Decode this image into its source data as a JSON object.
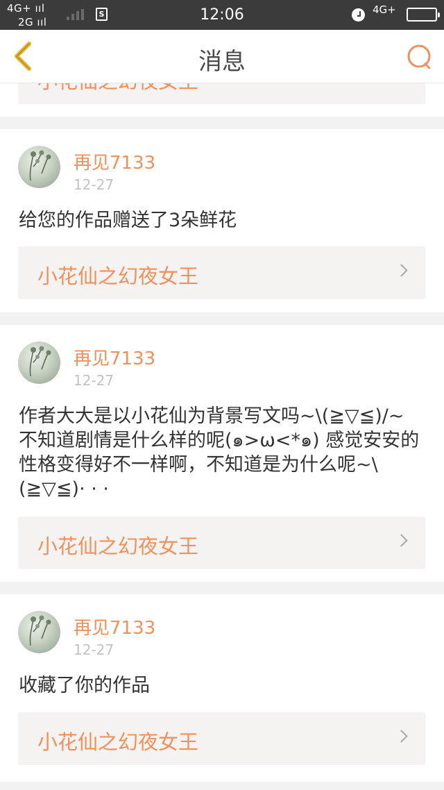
{
  "status_bar": {
    "network_top": "4G+ ııl",
    "network_bottom": "2G ııl",
    "sim_icon_label": "S",
    "time": "12:06",
    "network_right": "4G+"
  },
  "nav": {
    "title": "消息",
    "back_icon": "chevron-left-icon",
    "search_icon": "search-icon"
  },
  "work_link_label": "小花仙之幻夜女王",
  "messages": [
    {
      "username": "再见7133",
      "date": "12-27",
      "text": "给您的作品赠送了3朵鲜花",
      "work": "小花仙之幻夜女王"
    },
    {
      "username": "再见7133",
      "date": "12-27",
      "text": "作者大大是以小花仙为背景写文吗~\\(≧▽≦)/~不知道剧情是什么样的呢(๑>ω<*๑) 感觉安安的性格变得好不一样啊，不知道是为什么呢~\\(≧▽≦)· · ·",
      "work": "小花仙之幻夜女王"
    },
    {
      "username": "再见7133",
      "date": "12-27",
      "text": "收藏了你的作品",
      "work": "小花仙之幻夜女王"
    }
  ],
  "colors": {
    "accent": "#f0915a",
    "back_arrow": "#e8b52a",
    "status_bar_bg": "#3b3b3b"
  }
}
